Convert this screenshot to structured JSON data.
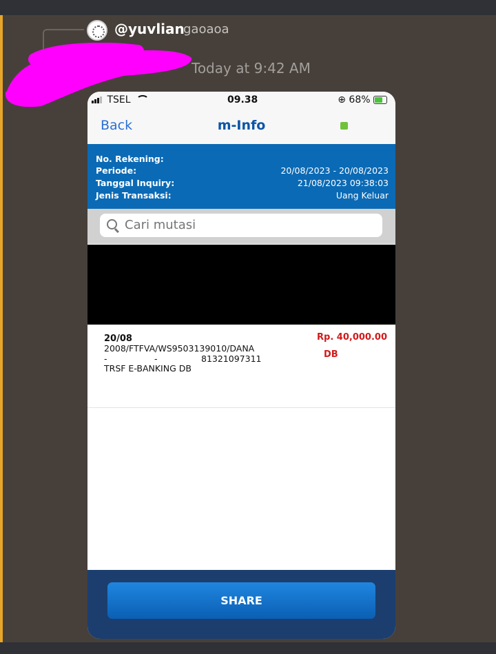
{
  "chat": {
    "reply_username": "@yuvlian",
    "reply_text": "gaoaoa",
    "timestamp": "Today at 9:42 AM",
    "redaction_color": "#ff00ff"
  },
  "phone": {
    "status": {
      "carrier": "TSEL",
      "time": "09.38",
      "battery": "68%"
    },
    "nav": {
      "back_label": "Back",
      "title": "m-Info"
    },
    "info": [
      {
        "label": "No. Rekening:",
        "value": ""
      },
      {
        "label": "Periode:",
        "value": "20/08/2023 - 20/08/2023"
      },
      {
        "label": "Tanggal Inquiry:",
        "value": "21/08/2023 09:38:03"
      },
      {
        "label": "Jenis Transaksi:",
        "value": "Uang Keluar"
      }
    ],
    "search": {
      "placeholder": "Cari mutasi"
    },
    "transaction": {
      "date": "20/08",
      "line1": "2008/FTFVA/WS9503139010/DANA",
      "line2a": "-",
      "line2b": "-",
      "line2c": "81321097311",
      "line3": "TRSF E-BANKING DB",
      "amount": "Rp.  40,000.00",
      "type": "DB"
    },
    "share_label": "SHARE",
    "colors": {
      "header_blue": "#0b6ab5",
      "amount_red": "#d11a1a",
      "footer_navy": "#1c3e6e"
    }
  }
}
